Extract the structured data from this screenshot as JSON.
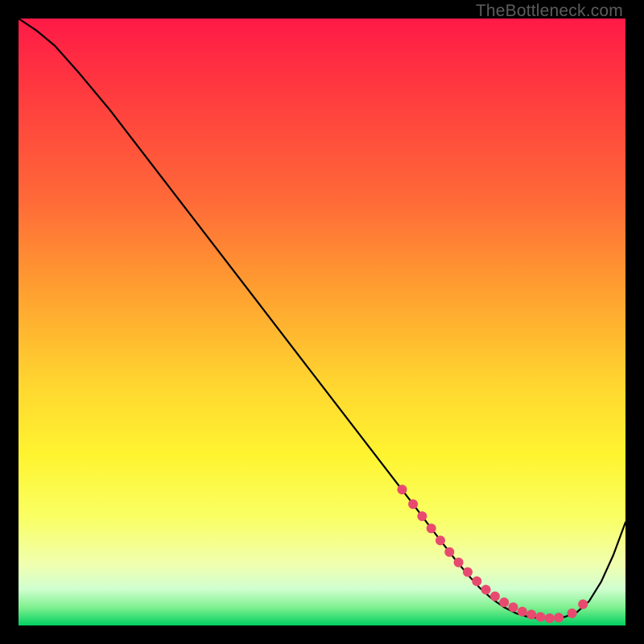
{
  "watermark": "TheBottleneck.com",
  "colors": {
    "curve": "#000000",
    "dot": "#e84a6f",
    "frame": "#000000"
  },
  "chart_data": {
    "type": "line",
    "title": "",
    "xlabel": "",
    "ylabel": "",
    "xlim": [
      0,
      100
    ],
    "ylim": [
      0,
      100
    ],
    "x": [
      0,
      3,
      6,
      10,
      15,
      20,
      25,
      30,
      35,
      40,
      45,
      50,
      55,
      60,
      63,
      65,
      68,
      70,
      72,
      74,
      76,
      78,
      80,
      82,
      84,
      86,
      88,
      90,
      92,
      94,
      96,
      98,
      100
    ],
    "y": [
      100,
      98,
      95.5,
      91,
      85,
      78.5,
      72,
      65.5,
      59,
      52.5,
      46,
      39.5,
      33,
      26.5,
      22.6,
      20,
      16,
      13.4,
      10.8,
      8.4,
      6.2,
      4.4,
      3.0,
      2.0,
      1.4,
      1.2,
      1.2,
      1.4,
      2.2,
      4.0,
      7.2,
      11.6,
      17
    ],
    "annotations": {
      "marker_x": [
        63.2,
        65.0,
        66.5,
        68.0,
        69.5,
        71.0,
        72.5,
        74.0,
        75.5,
        77.0,
        78.5,
        80.0,
        81.5,
        83.0,
        84.5,
        86.0,
        87.5,
        89.0,
        91.2,
        93.0
      ],
      "marker_y": [
        22.4,
        20.0,
        18.0,
        16.0,
        14.0,
        12.1,
        10.4,
        8.8,
        7.3,
        5.9,
        4.8,
        3.8,
        3.0,
        2.3,
        1.8,
        1.4,
        1.2,
        1.3,
        2.0,
        3.5
      ],
      "marker_radius": 6
    }
  }
}
